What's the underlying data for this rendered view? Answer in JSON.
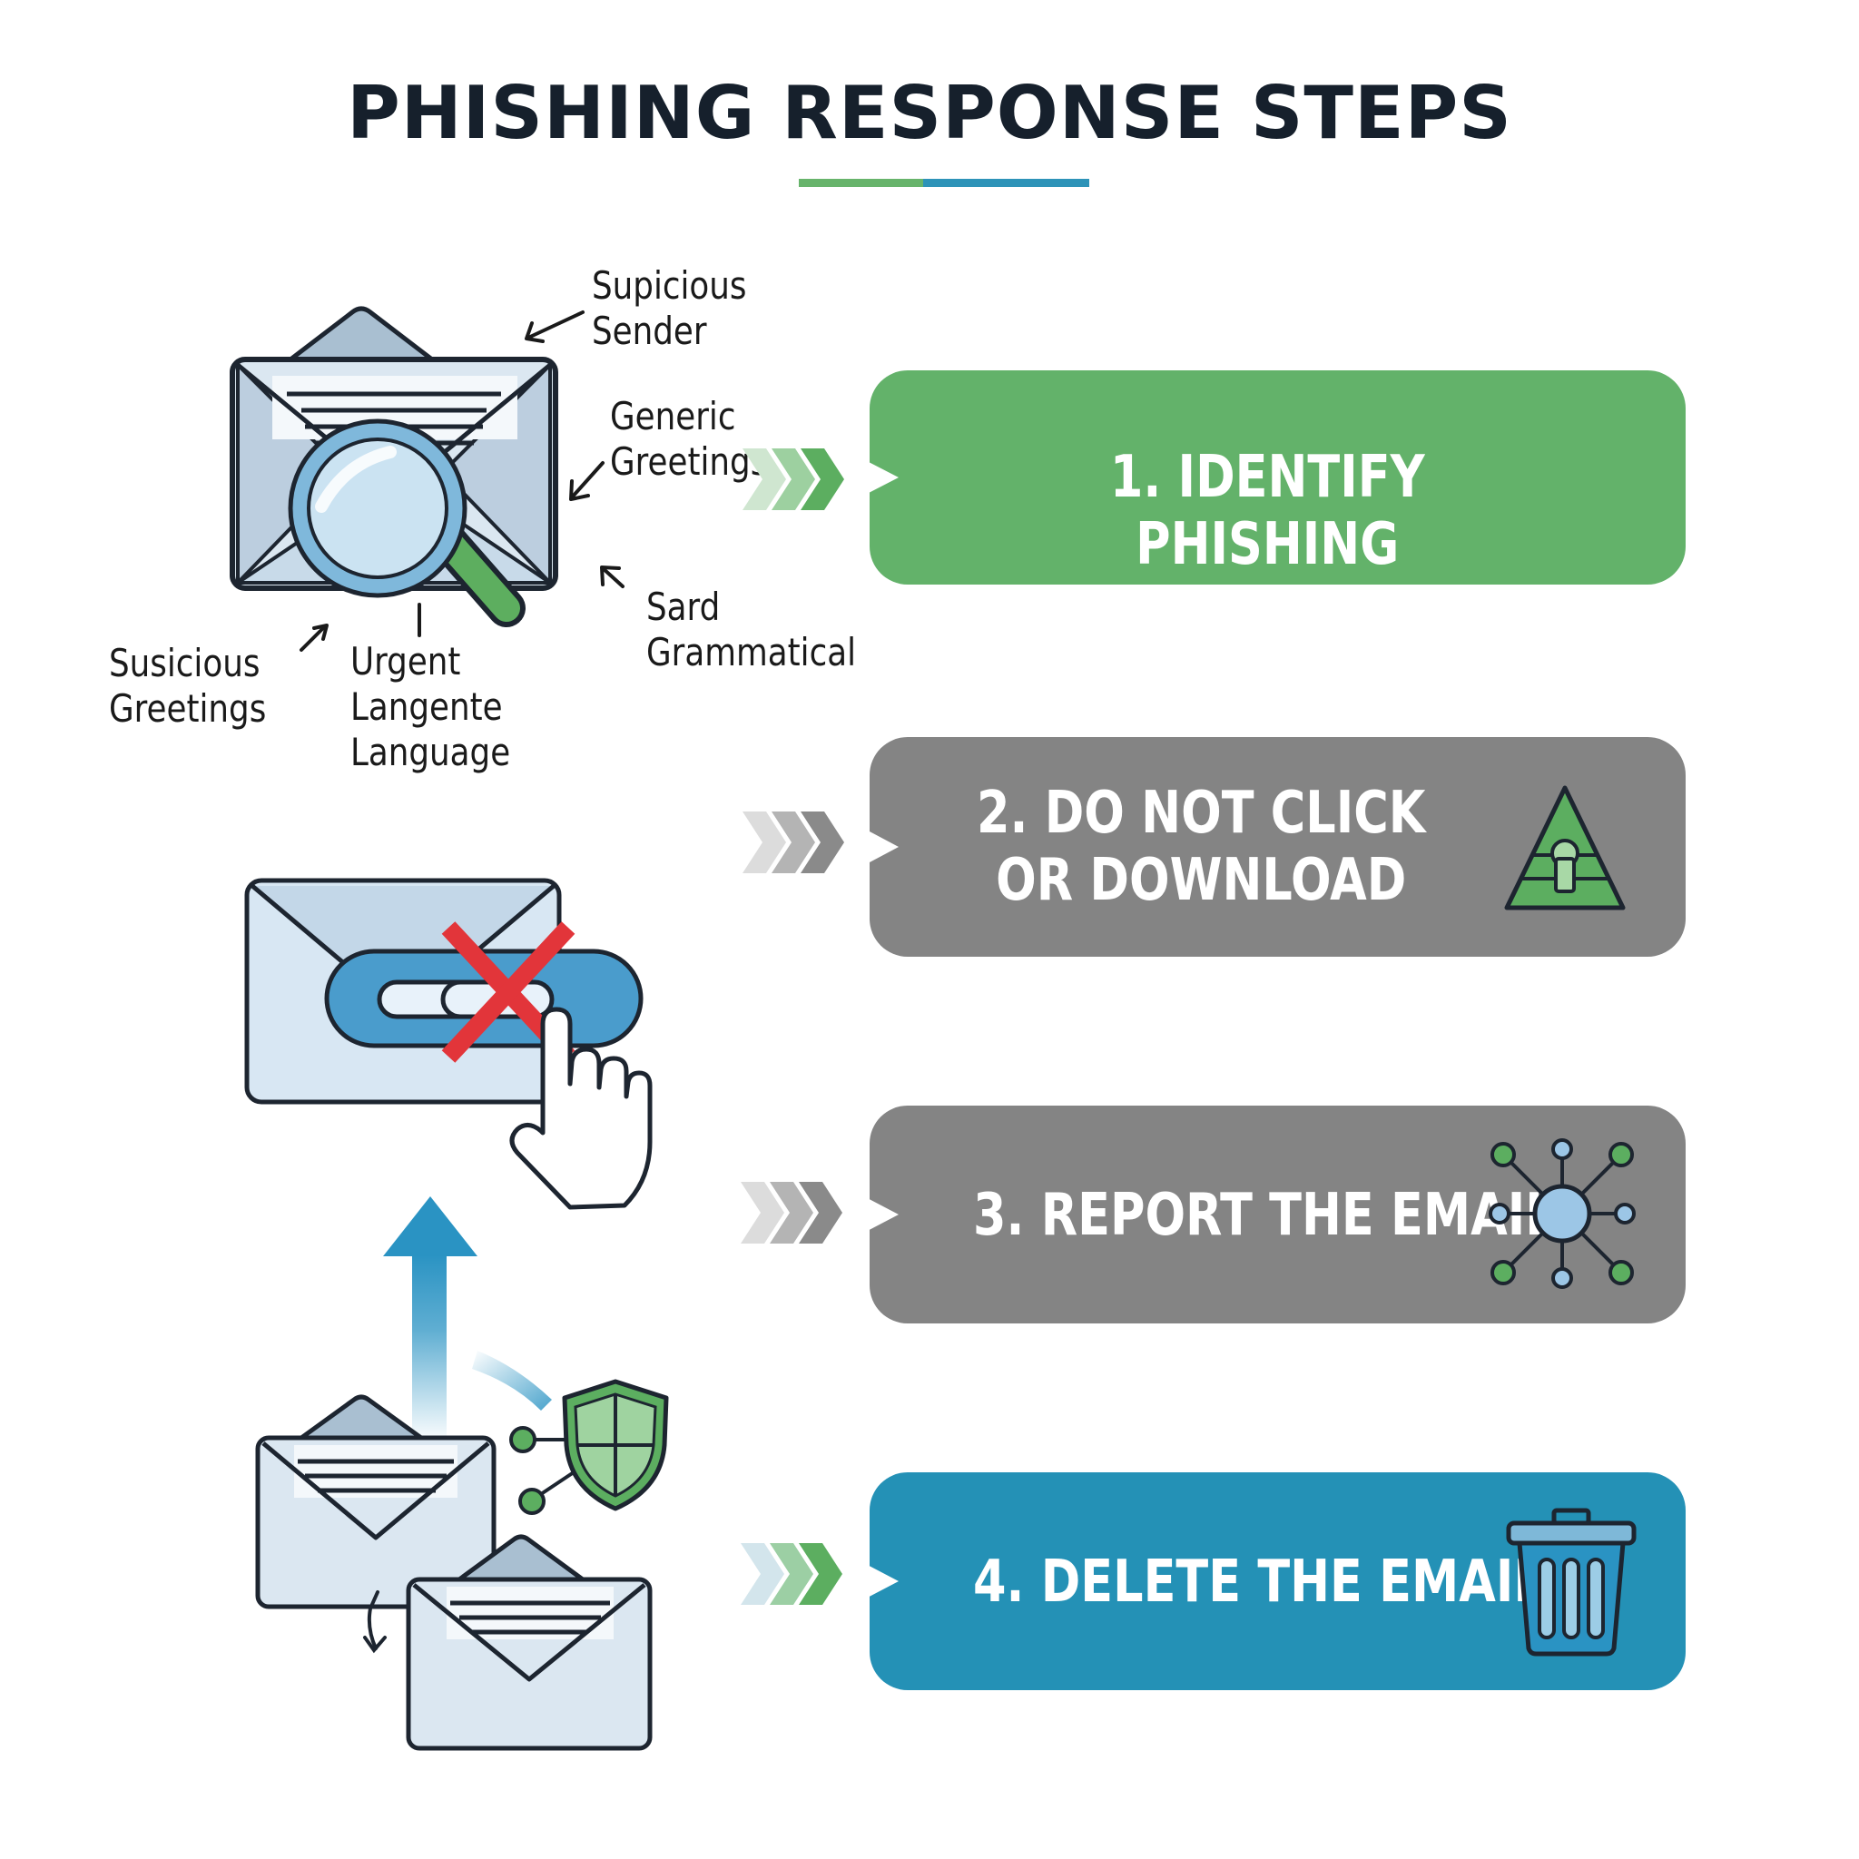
{
  "title": "PHISHING RESPONSE STEPS",
  "colors": {
    "green": "#63b26a",
    "gray": "#848484",
    "blue": "#2491b6",
    "dark": "#16202c"
  },
  "callouts": {
    "suspicious_sender": "Supicious\nSender",
    "generic_greetings": "Generic\nGreetings",
    "grammatical": "Sard\nGrammatical",
    "suspicious_greetings": "Susicious\nGreetings",
    "urgent_language": "Urgent\nLangente\nLanguage"
  },
  "steps": [
    {
      "label": "1. IDENTIFY PHISHING",
      "color": "#63b26a",
      "icon": "none"
    },
    {
      "label": "2. DO NOT CLICK\nOR DOWNLOAD",
      "color": "#848484",
      "icon": "warning-triangle-lock-icon"
    },
    {
      "label": "3. REPORT THE EMAIL",
      "color": "#848484",
      "icon": "network-hub-icon"
    },
    {
      "label": "4. DELETE THE EMAIL",
      "color": "#2491b6",
      "icon": "trash-can-icon"
    }
  ]
}
